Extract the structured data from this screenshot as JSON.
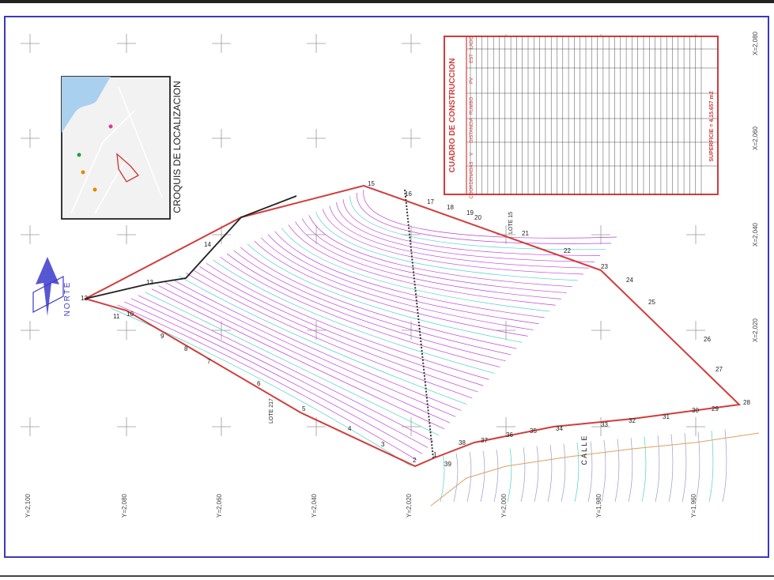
{
  "map": {
    "inset_title": "CROQUIS DE LOCALIZACION",
    "north_label": "NORTE",
    "table": {
      "title": "CUADRO DE CONSTRUCCION",
      "headers": [
        "LADO",
        "EST",
        "PV",
        "RUMBO",
        "DISTANCIA",
        "V",
        "COORDENADAS"
      ],
      "superficie": "SUPERFICIE = 4,15.657 m2"
    },
    "x_axis_labels": [
      "X=2,080",
      "X=2,060",
      "X=2,040",
      "X=2,020"
    ],
    "y_axis_labels": [
      "Y=2,100",
      "Y=2,080",
      "Y=2,060",
      "Y=2,040",
      "Y=2,020",
      "Y=2,000",
      "Y=1,980",
      "Y=1,960"
    ],
    "neighbor_labels": {
      "lote_15": "LOTE 15",
      "lote_217": "LOTE 217",
      "calle": "C A L L E"
    },
    "vertex_labels": [
      "12",
      "11",
      "10",
      "9",
      "8",
      "7",
      "6",
      "5",
      "4",
      "3",
      "2",
      "1",
      "39",
      "38",
      "37",
      "36",
      "35",
      "34",
      "33",
      "32",
      "31",
      "30",
      "29",
      "28",
      "27",
      "26",
      "25",
      "24",
      "23",
      "22",
      "21",
      "20",
      "19",
      "18",
      "17",
      "16",
      "15",
      "14",
      "13"
    ]
  }
}
